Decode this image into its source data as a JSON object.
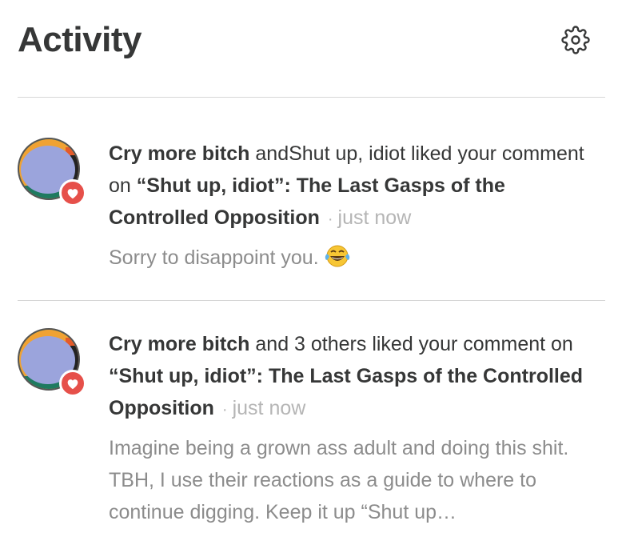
{
  "header": {
    "title": "Activity",
    "settings_icon": "gear-icon"
  },
  "items": [
    {
      "actor": "Cry more bitch",
      "connector": " andShut up, idiot liked your comment on ",
      "post_title": "“Shut up, idiot”: The Last Gasps of the Controlled Opposition",
      "dot": "·",
      "time": "just now",
      "snippet": "Sorry to disappoint you.",
      "emoji": "laughing-tears-emoji"
    },
    {
      "actor": "Cry more bitch",
      "connector": " and 3 others liked your comment on ",
      "post_title": "“Shut up, idiot”: The Last Gasps of the Controlled Opposition",
      "dot": "·",
      "time": "just now",
      "snippet": "Imagine being a grown ass adult and doing this shit. TBH, I use their reactions as a guide to where to continue digging. Keep it up “Shut up…"
    }
  ],
  "colors": {
    "badge": "#e6504a",
    "text": "#363737",
    "muted": "#8c8c8c",
    "timestamp": "#b5b5b5",
    "divider": "#d6d6d6"
  }
}
